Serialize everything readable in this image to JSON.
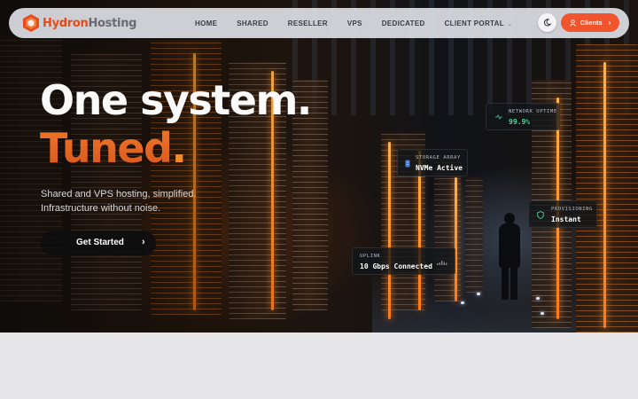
{
  "brand": {
    "name_part1": "Hydron",
    "name_part2": "Hosting",
    "accent": "#f2542d"
  },
  "nav": {
    "links": [
      "HOME",
      "SHARED",
      "RESELLER",
      "VPS",
      "DEDICATED",
      "CLIENT PORTAL"
    ],
    "client_portal_has_dropdown": true,
    "theme_toggle_icon": "moon-icon",
    "clients_button": {
      "label": "Clients",
      "icon": "user-icon",
      "arrow": "›"
    }
  },
  "hero": {
    "title_line1": "One system.",
    "title_line2": "Tuned",
    "title_line2_punct": ".",
    "subtitle_line1": "Shared and VPS hosting, simplified.",
    "subtitle_line2": "Infrastructure without noise.",
    "cta_label": "Get Started",
    "cta_arrow": "›"
  },
  "stats": {
    "network": {
      "label": "NETWORK UPTIME",
      "value": "99.9%",
      "icon": "activity-icon",
      "color": "#3ddc97"
    },
    "storage": {
      "label": "STORAGE ARRAY",
      "value": "NVMe Active",
      "icon": "storage-icon",
      "color": "#ffffff"
    },
    "provisioning": {
      "label": "PROVISIONING",
      "value": "Instant",
      "icon": "shield-icon",
      "color": "#ffffff"
    },
    "uplink": {
      "label": "UPLINK",
      "value": "10 Gbps Connected",
      "icon": "bars-icon",
      "color": "#ffffff"
    }
  }
}
